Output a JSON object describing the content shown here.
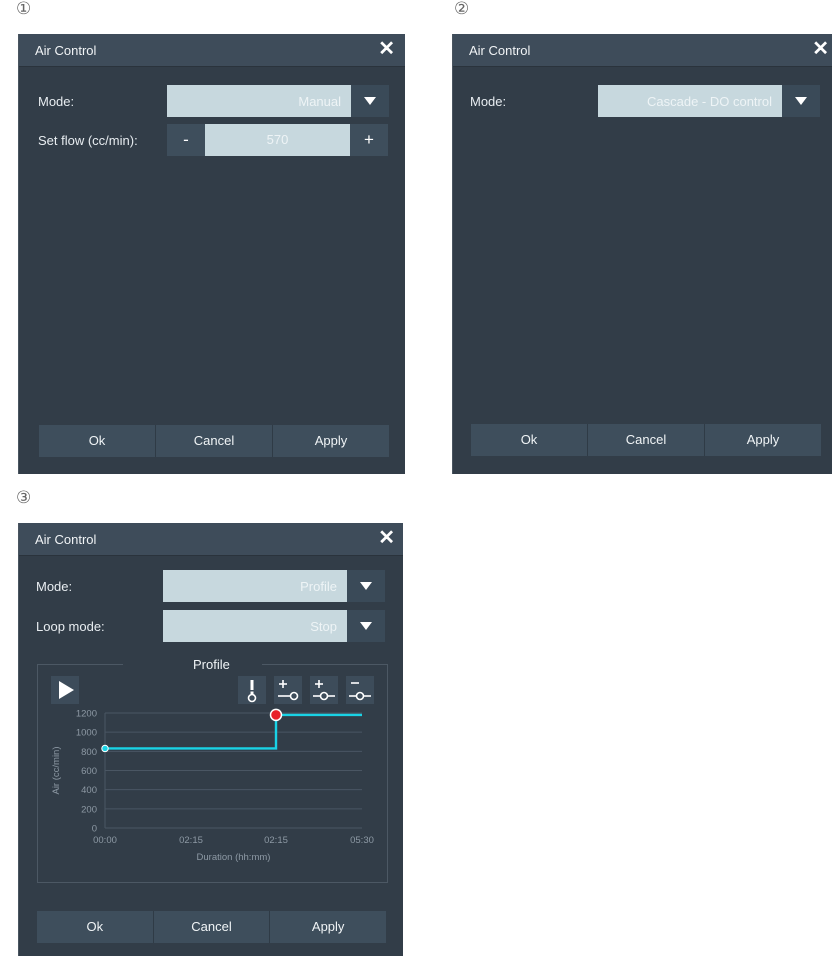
{
  "markers": [
    "①",
    "②",
    "③"
  ],
  "dialog1": {
    "title": "Air Control",
    "mode_label": "Mode:",
    "mode_value": "Manual",
    "flow_label": "Set flow (cc/min):",
    "minus": "-",
    "flow_value": "570",
    "plus": "+",
    "buttons": [
      "Ok",
      "Cancel",
      "Apply"
    ]
  },
  "dialog2": {
    "title": "Air Control",
    "mode_label": "Mode:",
    "mode_value": "Cascade - DO control",
    "buttons": [
      "Ok",
      "Cancel",
      "Apply"
    ]
  },
  "dialog3": {
    "title": "Air Control",
    "mode_label": "Mode:",
    "mode_value": "Profile",
    "loop_label": "Loop mode:",
    "loop_value": "Stop",
    "profile_title": "Profile",
    "buttons": [
      "Ok",
      "Cancel",
      "Apply"
    ],
    "icons": [
      "play-icon",
      "profile-point-alert-icon",
      "add-point-after-icon",
      "insert-point-icon",
      "remove-point-icon"
    ]
  },
  "chart_data": {
    "type": "line",
    "title": "Profile",
    "xlabel": "Duration (hh:mm)",
    "ylabel": "Air (cc/min)",
    "x_ticks": [
      "00:00",
      "02:15",
      "02:15",
      "05:30"
    ],
    "y_ticks": [
      0,
      200,
      400,
      600,
      800,
      1000,
      1200
    ],
    "ylim": [
      0,
      1200
    ],
    "grid": true,
    "series": [
      {
        "color": "#19d3e6",
        "points": [
          {
            "x": "00:00",
            "y": 830
          },
          {
            "x": "02:15",
            "y": 830
          },
          {
            "x": "02:15",
            "y": 1180
          },
          {
            "x": "05:30",
            "y": 1180
          }
        ]
      }
    ],
    "markers": [
      {
        "x": "00:00",
        "y": 830,
        "color": "#19d3e6"
      },
      {
        "x": "02:15",
        "y": 1180,
        "color": "#e8202a",
        "selected": true
      }
    ]
  }
}
